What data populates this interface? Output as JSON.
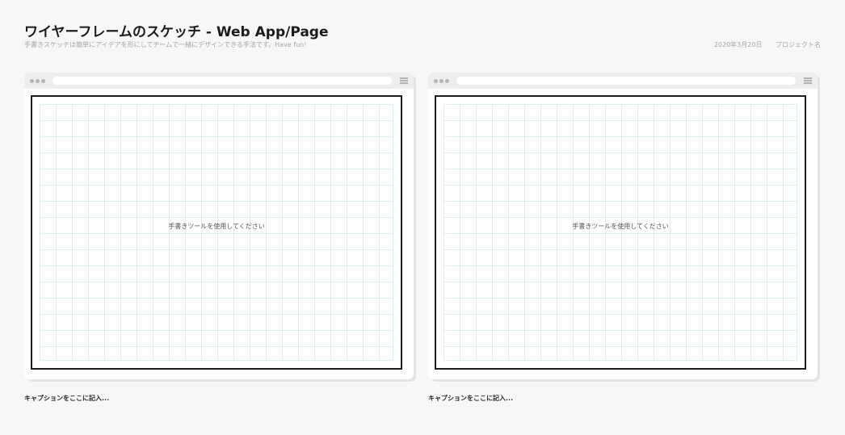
{
  "header": {
    "title": "ワイヤーフレームのスケッチ - Web App/Page",
    "subtitle": "手書きスケッチは簡単にアイデアを形にしてチームで一緒にデザインできる手法です。Have fun!",
    "date": "2020年3月20日",
    "project": "プロジェクト名"
  },
  "frames": [
    {
      "hint": "手書きツールを使用してください",
      "caption": "キャプションをここに記入..."
    },
    {
      "hint": "手書きツールを使用してください",
      "caption": "キャプションをここに記入..."
    }
  ],
  "icons": {
    "window_dots": "window-dots-icon",
    "menu": "hamburger-menu-icon"
  },
  "colors": {
    "background": "#f7f7f7",
    "grid_line": "#dbeef0",
    "canvas_border": "#1e1e1e",
    "chrome": "#eeeeee"
  }
}
